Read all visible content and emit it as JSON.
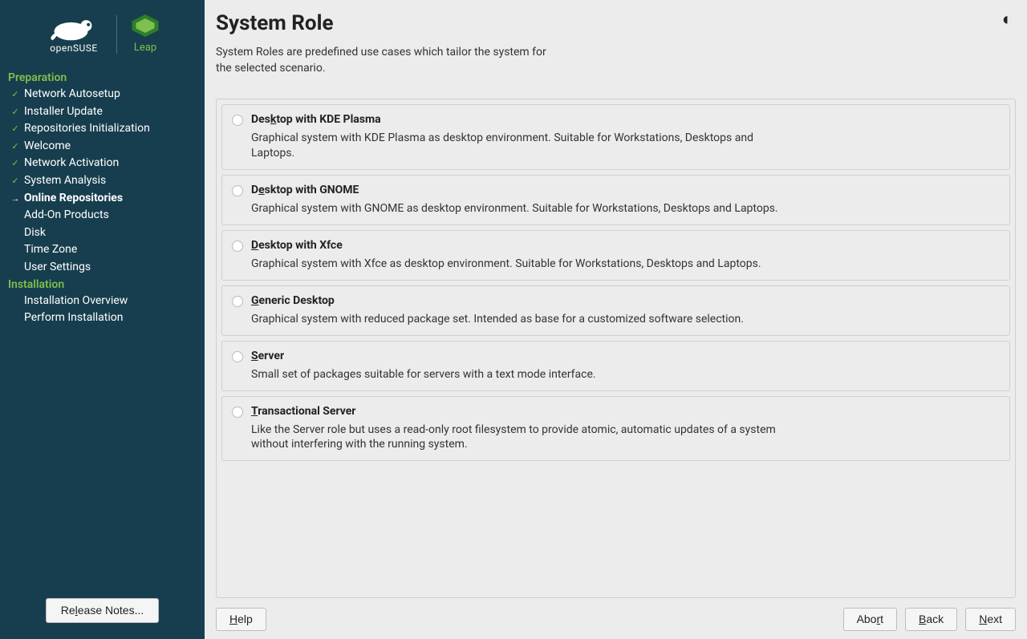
{
  "branding": {
    "suse_label": "openSUSE",
    "leap_label": "Leap"
  },
  "sidebar": {
    "sections": [
      {
        "heading": "Preparation",
        "items": [
          {
            "label": "Network Autosetup",
            "status": "done"
          },
          {
            "label": "Installer Update",
            "status": "done"
          },
          {
            "label": "Repositories Initialization",
            "status": "done"
          },
          {
            "label": "Welcome",
            "status": "done"
          },
          {
            "label": "Network Activation",
            "status": "done"
          },
          {
            "label": "System Analysis",
            "status": "done"
          },
          {
            "label": "Online Repositories",
            "status": "current"
          },
          {
            "label": "Add-On Products",
            "status": "pending"
          },
          {
            "label": "Disk",
            "status": "pending"
          },
          {
            "label": "Time Zone",
            "status": "pending"
          },
          {
            "label": "User Settings",
            "status": "pending"
          }
        ]
      },
      {
        "heading": "Installation",
        "items": [
          {
            "label": "Installation Overview",
            "status": "pending"
          },
          {
            "label": "Perform Installation",
            "status": "pending"
          }
        ]
      }
    ],
    "release_notes": "Release Notes...",
    "release_notes_accel_index": 2
  },
  "page": {
    "title": "System Role",
    "subtitle": "System Roles are predefined use cases which tailor the system for the selected scenario."
  },
  "roles": [
    {
      "title": "Desktop with KDE Plasma",
      "accel_index": 3,
      "desc": "Graphical system with KDE Plasma as desktop environment. Suitable for Workstations, Desktops and Laptops."
    },
    {
      "title": "Desktop with GNOME",
      "accel_index": 1,
      "desc": "Graphical system with GNOME as desktop environment. Suitable for Workstations, Desktops and Laptops."
    },
    {
      "title": "Desktop with Xfce",
      "accel_index": 0,
      "desc": "Graphical system with Xfce as desktop environment. Suitable for Workstations, Desktops and Laptops."
    },
    {
      "title": "Generic Desktop",
      "accel_index": 0,
      "desc": "Graphical system with reduced package set. Intended as base for a customized software selection."
    },
    {
      "title": "Server",
      "accel_index": 0,
      "desc": "Small set of packages suitable for servers with a text mode interface."
    },
    {
      "title": "Transactional Server",
      "accel_index": 0,
      "desc": "Like the Server role but uses a read-only root filesystem to provide atomic, automatic updates of a system without interfering with the running system."
    }
  ],
  "footer": {
    "help": "Help",
    "help_accel": 0,
    "abort": "Abort",
    "abort_accel": 3,
    "back": "Back",
    "back_accel": 0,
    "next": "Next",
    "next_accel": 0
  }
}
